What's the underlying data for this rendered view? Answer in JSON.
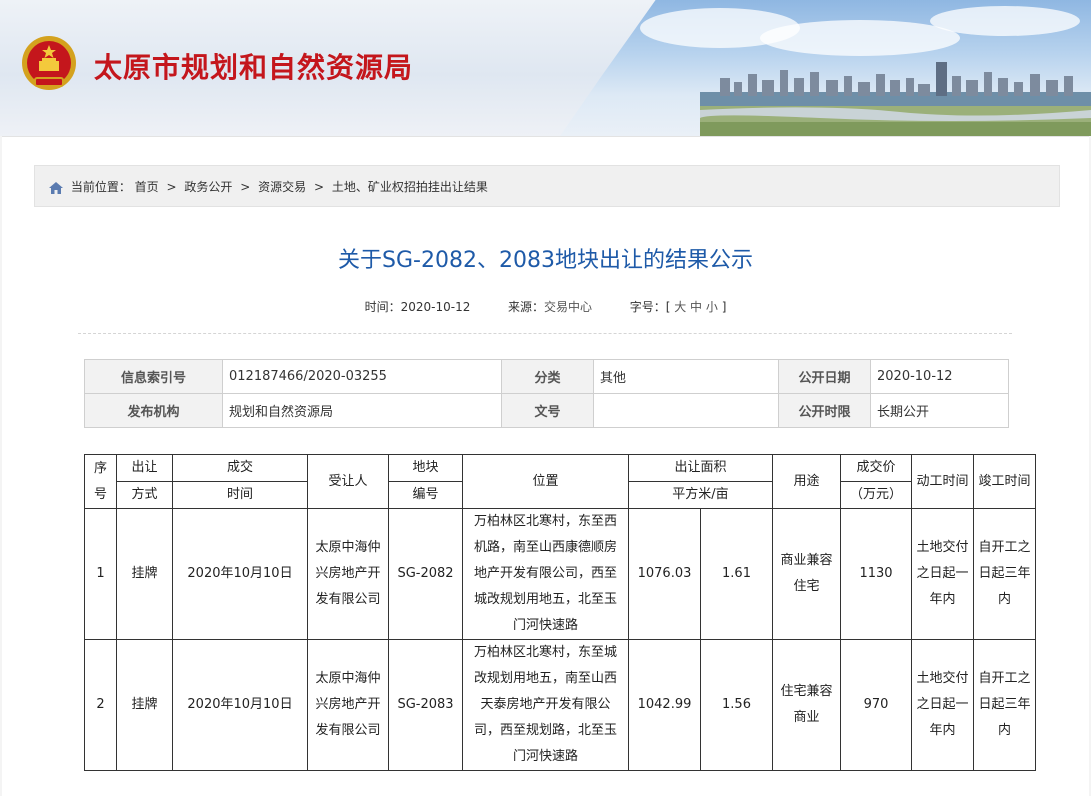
{
  "site": {
    "title": "太原市规划和自然资源局"
  },
  "breadcrumb": {
    "prefix": "当前位置：",
    "items": [
      "首页",
      "政务公开",
      "资源交易",
      "土地、矿业权招拍挂出让结果"
    ],
    "sep": ">"
  },
  "article": {
    "title": "关于SG-2082、2083地块出让的结果公示",
    "time_label": "时间：",
    "time": "2020-10-12",
    "source_label": "来源：",
    "source": "交易中心",
    "font_label": "字号：[",
    "font_sizes": [
      "大",
      "中",
      "小"
    ],
    "font_end": "]"
  },
  "info": {
    "index_label": "信息索引号",
    "index": "012187466/2020-03255",
    "category_label": "分类",
    "category": "其他",
    "pubdate_label": "公开日期",
    "pubdate": "2020-10-12",
    "org_label": "发布机构",
    "org": "规划和自然资源局",
    "docno_label": "文号",
    "docno": "",
    "period_label": "公开时限",
    "period": "长期公开"
  },
  "results": {
    "headers": {
      "seq": "序号",
      "method_1": "出让",
      "method_2": "方式",
      "date_1": "成交",
      "date_2": "时间",
      "buyer": "受让人",
      "lot_1": "地块",
      "lot_2": "编号",
      "location": "位置",
      "area_1": "出让面积",
      "area_2": "平方米/亩",
      "use": "用途",
      "price_1": "成交价",
      "price_2": "（万元）",
      "start": "动工时间",
      "finish": "竣工时间"
    },
    "rows": [
      {
        "seq": "1",
        "method": "挂牌",
        "date": "2020年10月10日",
        "buyer": [
          "太原中海仲",
          "兴房地产开",
          "发有限公司"
        ],
        "lot": "SG-2082",
        "location": [
          "万柏林区北寒村，东至西",
          "机路，南至山西康德顺房",
          "地产开发有限公司，西至",
          "城改规划用地五，北至玉",
          "门河快速路"
        ],
        "area_m2": "1076.03",
        "area_mu": "1.61",
        "use": [
          "商业兼容",
          "住宅"
        ],
        "price": "1130",
        "start": [
          "土地交付",
          "之日起一",
          "年内"
        ],
        "finish": [
          "自开工之",
          "日起三年",
          "内"
        ]
      },
      {
        "seq": "2",
        "method": "挂牌",
        "date": "2020年10月10日",
        "buyer": [
          "太原中海仲",
          "兴房地产开",
          "发有限公司"
        ],
        "lot": "SG-2083",
        "location": [
          "万柏林区北寒村，东至城",
          "改规划用地五，南至山西",
          "天泰房地产开发有限公",
          "司，西至规划路，北至玉",
          "门河快速路"
        ],
        "area_m2": "1042.99",
        "area_mu": "1.56",
        "use": [
          "住宅兼容",
          "商业"
        ],
        "price": "970",
        "start": [
          "土地交付",
          "之日起一",
          "年内"
        ],
        "finish": [
          "自开工之",
          "日起三年",
          "内"
        ]
      }
    ]
  }
}
